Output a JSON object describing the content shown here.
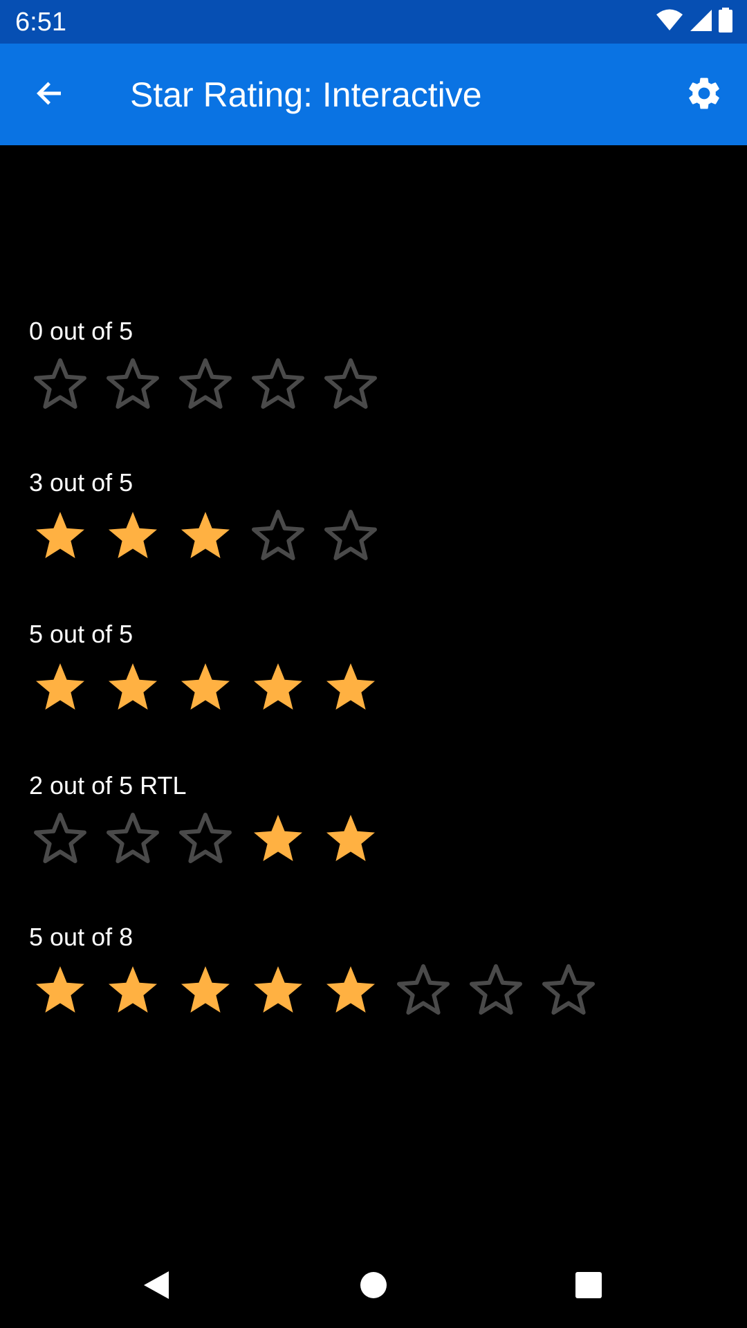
{
  "status_bar": {
    "time": "6:51",
    "icons": [
      "wifi-icon",
      "cell-signal-icon",
      "battery-icon"
    ]
  },
  "app_bar": {
    "title": "Star Rating: Interactive",
    "back_icon": "arrow-back-icon",
    "settings_icon": "gear-icon"
  },
  "colors": {
    "status_bar": "#064fb3",
    "app_bar": "#0a73e3",
    "background": "#000000",
    "star_filled": "#ffb142",
    "star_empty_outline": "#4a4a4a"
  },
  "ratings": [
    {
      "label": "0 out of 5",
      "value": 0,
      "max": 5,
      "rtl": false
    },
    {
      "label": "3 out of 5",
      "value": 3,
      "max": 5,
      "rtl": false
    },
    {
      "label": "5 out of 5",
      "value": 5,
      "max": 5,
      "rtl": false
    },
    {
      "label": "2 out of 5 RTL",
      "value": 2,
      "max": 5,
      "rtl": true
    },
    {
      "label": "5 out of 8",
      "value": 5,
      "max": 8,
      "rtl": false
    }
  ],
  "nav_bar": {
    "buttons": [
      "back-triangle-icon",
      "home-circle-icon",
      "recents-square-icon"
    ]
  }
}
